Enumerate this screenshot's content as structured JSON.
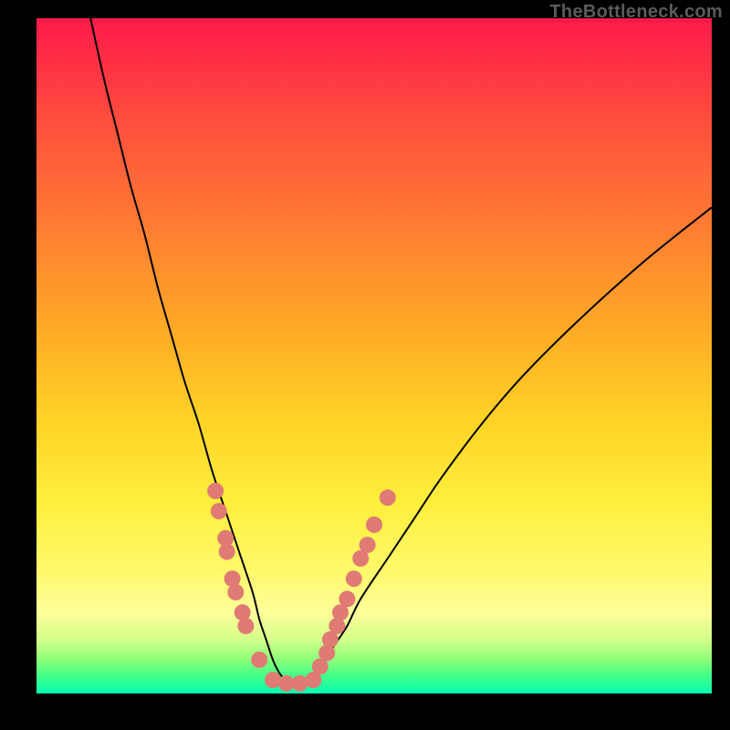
{
  "watermark": "TheBottleneck.com",
  "chart_data": {
    "type": "line",
    "title": "",
    "xlabel": "",
    "ylabel": "",
    "xlim": [
      0,
      100
    ],
    "ylim": [
      0,
      100
    ],
    "grid": false,
    "legend": false,
    "series": [
      {
        "name": "bottleneck-curve",
        "x": [
          8,
          10,
          12,
          14,
          16,
          18,
          20,
          22,
          24,
          26,
          28,
          30,
          32,
          33,
          34,
          35,
          36,
          37,
          38,
          40,
          42,
          44,
          46,
          48,
          52,
          56,
          60,
          66,
          72,
          80,
          90,
          100
        ],
        "y": [
          100,
          91,
          83,
          75,
          68,
          60,
          53,
          46,
          40,
          33,
          27,
          21,
          15,
          11,
          8,
          5,
          3,
          2,
          2,
          2,
          4,
          7,
          10,
          14,
          20,
          26,
          32,
          40,
          47,
          55,
          64,
          72
        ],
        "color": "#000000"
      }
    ],
    "markers": [
      {
        "name": "data-points-left",
        "color": "#e07a74",
        "points": [
          {
            "x": 26.5,
            "y": 30
          },
          {
            "x": 27.0,
            "y": 27
          },
          {
            "x": 28.0,
            "y": 23
          },
          {
            "x": 28.2,
            "y": 21
          },
          {
            "x": 29.0,
            "y": 17
          },
          {
            "x": 29.5,
            "y": 15
          },
          {
            "x": 30.5,
            "y": 12
          },
          {
            "x": 31.0,
            "y": 10
          },
          {
            "x": 33.0,
            "y": 5
          },
          {
            "x": 35.0,
            "y": 2
          },
          {
            "x": 37.0,
            "y": 1.5
          },
          {
            "x": 39.0,
            "y": 1.5
          }
        ]
      },
      {
        "name": "data-points-right",
        "color": "#e07a74",
        "points": [
          {
            "x": 41.0,
            "y": 2
          },
          {
            "x": 42.0,
            "y": 4
          },
          {
            "x": 43.0,
            "y": 6
          },
          {
            "x": 43.5,
            "y": 8
          },
          {
            "x": 44.5,
            "y": 10
          },
          {
            "x": 45.0,
            "y": 12
          },
          {
            "x": 46.0,
            "y": 14
          },
          {
            "x": 47.0,
            "y": 17
          },
          {
            "x": 48.0,
            "y": 20
          },
          {
            "x": 49.0,
            "y": 22
          },
          {
            "x": 50.0,
            "y": 25
          },
          {
            "x": 52.0,
            "y": 29
          }
        ]
      }
    ]
  }
}
